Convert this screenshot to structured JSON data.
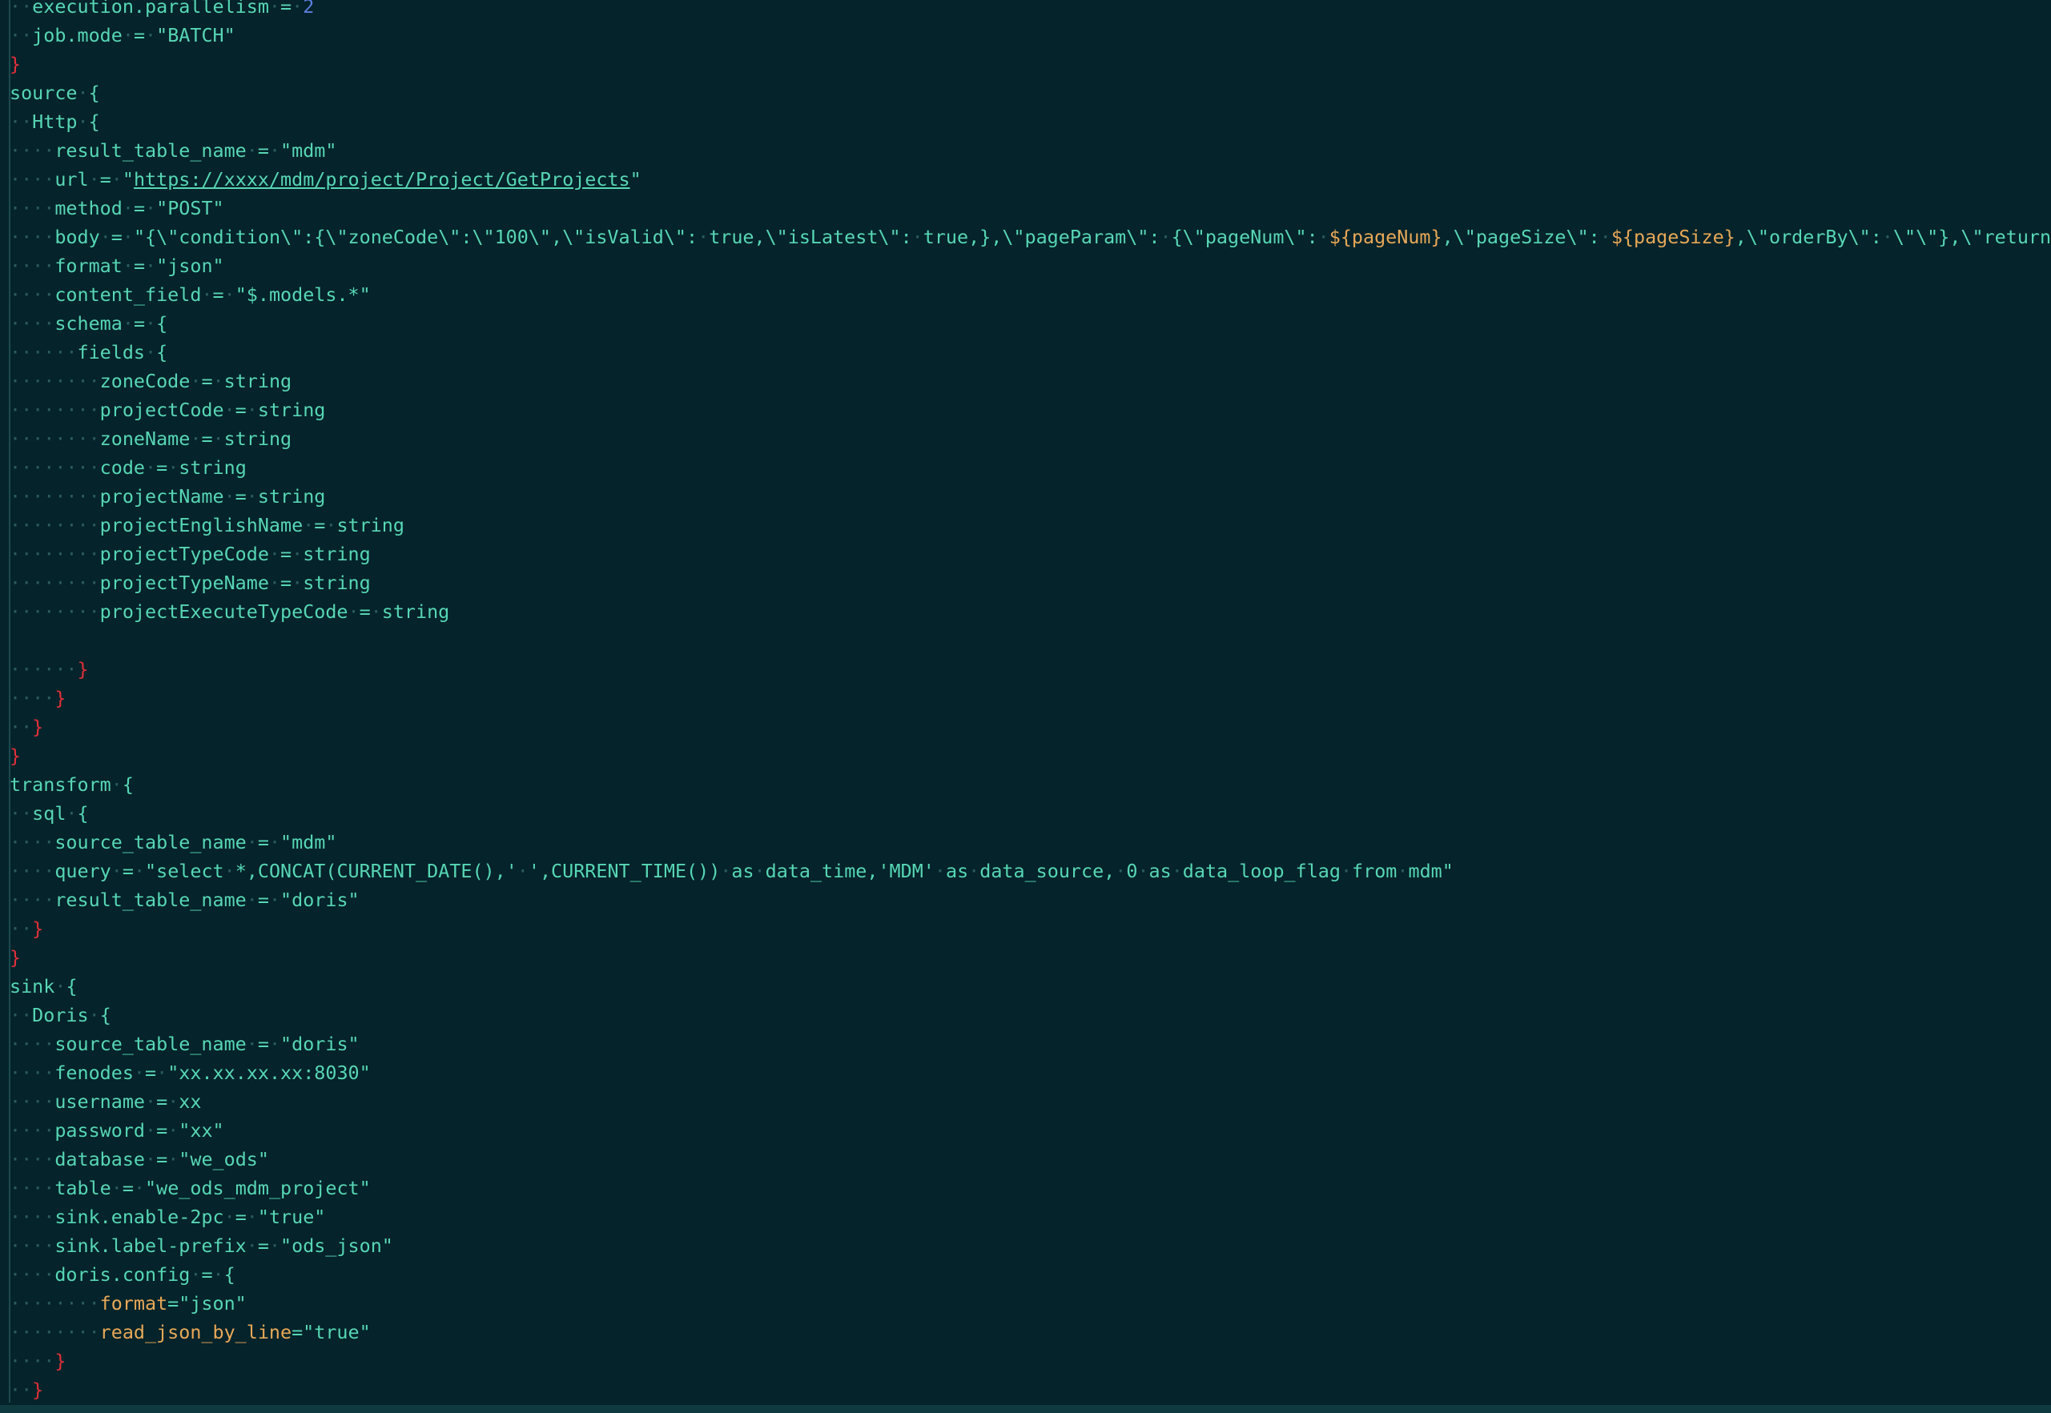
{
  "editor": {
    "lines": [
      [
        {
          "t": "··"
        },
        {
          "t": "execution.parallelism"
        },
        {
          "t": "·=·"
        },
        {
          "t": "2",
          "c": "blue"
        }
      ],
      [
        {
          "t": "··"
        },
        {
          "t": "job.mode"
        },
        {
          "t": "·=·"
        },
        {
          "t": "\"BATCH\""
        }
      ],
      [
        {
          "t": "}",
          "c": "brace-red"
        }
      ],
      [
        {
          "t": "source"
        },
        {
          "t": "·"
        },
        {
          "t": "{"
        }
      ],
      [
        {
          "t": "··"
        },
        {
          "t": "Http"
        },
        {
          "t": "·"
        },
        {
          "t": "{"
        }
      ],
      [
        {
          "t": "····"
        },
        {
          "t": "result_table_name"
        },
        {
          "t": "·=·"
        },
        {
          "t": "\"mdm\""
        }
      ],
      [
        {
          "t": "····"
        },
        {
          "t": "url"
        },
        {
          "t": "·=·"
        },
        {
          "t": "\""
        },
        {
          "t": "https://xxxx/mdm/project/Project/GetProjects",
          "c": "link"
        },
        {
          "t": "\""
        }
      ],
      [
        {
          "t": "····"
        },
        {
          "t": "method"
        },
        {
          "t": "·=·"
        },
        {
          "t": "\"POST\""
        }
      ],
      [
        {
          "t": "····"
        },
        {
          "t": "body"
        },
        {
          "t": "·=·"
        },
        {
          "t": "\"{\\\"condition\\\":{\\\"zoneCode\\\":\\\"100\\\",\\\"isValid\\\":·true,\\\"isLatest\\\":·true,},\\\"pageParam\\\":·{\\\"pageNum\\\":·"
        },
        {
          "t": "${pageNum}",
          "c": "orange"
        },
        {
          "t": ",\\\"pageSize\\\":·"
        },
        {
          "t": "${pageSize}",
          "c": "orange"
        },
        {
          "t": ",\\\"orderBy\\\":·\\\"\\\"},\\\"returnSetting\\"
        }
      ],
      [
        {
          "t": "····"
        },
        {
          "t": "format"
        },
        {
          "t": "·=·"
        },
        {
          "t": "\"json\""
        }
      ],
      [
        {
          "t": "····"
        },
        {
          "t": "content_field"
        },
        {
          "t": "·=·"
        },
        {
          "t": "\"$.models.*\""
        }
      ],
      [
        {
          "t": "····"
        },
        {
          "t": "schema"
        },
        {
          "t": "·=·"
        },
        {
          "t": "{"
        }
      ],
      [
        {
          "t": "······"
        },
        {
          "t": "fields"
        },
        {
          "t": "·"
        },
        {
          "t": "{"
        }
      ],
      [
        {
          "t": "········"
        },
        {
          "t": "zoneCode"
        },
        {
          "t": "·=·"
        },
        {
          "t": "string"
        }
      ],
      [
        {
          "t": "········"
        },
        {
          "t": "projectCode"
        },
        {
          "t": "·=·"
        },
        {
          "t": "string"
        }
      ],
      [
        {
          "t": "········"
        },
        {
          "t": "zoneName"
        },
        {
          "t": "·=·"
        },
        {
          "t": "string"
        }
      ],
      [
        {
          "t": "········"
        },
        {
          "t": "code"
        },
        {
          "t": "·=·"
        },
        {
          "t": "string"
        }
      ],
      [
        {
          "t": "········"
        },
        {
          "t": "projectName"
        },
        {
          "t": "·=·"
        },
        {
          "t": "string"
        }
      ],
      [
        {
          "t": "········"
        },
        {
          "t": "projectEnglishName"
        },
        {
          "t": "·=·"
        },
        {
          "t": "string"
        }
      ],
      [
        {
          "t": "········"
        },
        {
          "t": "projectTypeCode"
        },
        {
          "t": "·=·"
        },
        {
          "t": "string"
        }
      ],
      [
        {
          "t": "········"
        },
        {
          "t": "projectTypeName"
        },
        {
          "t": "·=·"
        },
        {
          "t": "string"
        }
      ],
      [
        {
          "t": "········"
        },
        {
          "t": "projectExecuteTypeCode"
        },
        {
          "t": "·=·"
        },
        {
          "t": "string"
        }
      ],
      [],
      [
        {
          "t": "······"
        },
        {
          "t": "}",
          "c": "brace-red"
        }
      ],
      [
        {
          "t": "····"
        },
        {
          "t": "}",
          "c": "brace-red"
        }
      ],
      [
        {
          "t": "··"
        },
        {
          "t": "}",
          "c": "brace-red"
        }
      ],
      [
        {
          "t": "}",
          "c": "brace-red"
        }
      ],
      [
        {
          "t": "transform"
        },
        {
          "t": "·"
        },
        {
          "t": "{"
        }
      ],
      [
        {
          "t": "··"
        },
        {
          "t": "sql"
        },
        {
          "t": "·"
        },
        {
          "t": "{"
        }
      ],
      [
        {
          "t": "····"
        },
        {
          "t": "source_table_name"
        },
        {
          "t": "·=·"
        },
        {
          "t": "\"mdm\""
        }
      ],
      [
        {
          "t": "····"
        },
        {
          "t": "query"
        },
        {
          "t": "·=·"
        },
        {
          "t": "\"select·*,CONCAT(CURRENT_DATE(),'·',CURRENT_TIME())·as·data_time,'MDM'·as·data_source,·0·as·data_loop_flag·from·mdm\""
        }
      ],
      [
        {
          "t": "····"
        },
        {
          "t": "result_table_name"
        },
        {
          "t": "·=·"
        },
        {
          "t": "\"doris\""
        }
      ],
      [
        {
          "t": "··"
        },
        {
          "t": "}",
          "c": "brace-red"
        }
      ],
      [
        {
          "t": "}",
          "c": "brace-red"
        }
      ],
      [
        {
          "t": "sink"
        },
        {
          "t": "·"
        },
        {
          "t": "{"
        }
      ],
      [
        {
          "t": "··"
        },
        {
          "t": "Doris"
        },
        {
          "t": "·"
        },
        {
          "t": "{"
        }
      ],
      [
        {
          "t": "····"
        },
        {
          "t": "source_table_name"
        },
        {
          "t": "·=·"
        },
        {
          "t": "\"doris\""
        }
      ],
      [
        {
          "t": "····"
        },
        {
          "t": "fenodes"
        },
        {
          "t": "·=·"
        },
        {
          "t": "\"xx.xx.xx.xx:8030\""
        }
      ],
      [
        {
          "t": "····"
        },
        {
          "t": "username"
        },
        {
          "t": "·=·"
        },
        {
          "t": "xx"
        }
      ],
      [
        {
          "t": "····"
        },
        {
          "t": "password"
        },
        {
          "t": "·=·"
        },
        {
          "t": "\"xx\""
        }
      ],
      [
        {
          "t": "····"
        },
        {
          "t": "database"
        },
        {
          "t": "·=·"
        },
        {
          "t": "\"we_ods\""
        }
      ],
      [
        {
          "t": "····"
        },
        {
          "t": "table"
        },
        {
          "t": "·=·"
        },
        {
          "t": "\"we_ods_mdm_project\""
        }
      ],
      [
        {
          "t": "····"
        },
        {
          "t": "sink.enable-2pc"
        },
        {
          "t": "·=·"
        },
        {
          "t": "\"true\""
        }
      ],
      [
        {
          "t": "····"
        },
        {
          "t": "sink.label-prefix"
        },
        {
          "t": "·=·"
        },
        {
          "t": "\"ods_json\""
        }
      ],
      [
        {
          "t": "····"
        },
        {
          "t": "doris.config"
        },
        {
          "t": "·=·"
        },
        {
          "t": "{"
        }
      ],
      [
        {
          "t": "········"
        },
        {
          "t": "format",
          "c": "orange"
        },
        {
          "t": "=\"json\""
        }
      ],
      [
        {
          "t": "········"
        },
        {
          "t": "read_json_by_line",
          "c": "orange"
        },
        {
          "t": "=\"true\""
        }
      ],
      [
        {
          "t": "····"
        },
        {
          "t": "}",
          "c": "brace-red"
        }
      ],
      [
        {
          "t": "··"
        },
        {
          "t": "}",
          "c": "brace-red"
        }
      ]
    ]
  },
  "colors": {
    "background": "#04232a",
    "text": "#57d6b4",
    "whitespace_dot": "#2a5b5f",
    "brace": "#e0303a",
    "variable": "#e7a857",
    "number": "#5c7fe0"
  }
}
